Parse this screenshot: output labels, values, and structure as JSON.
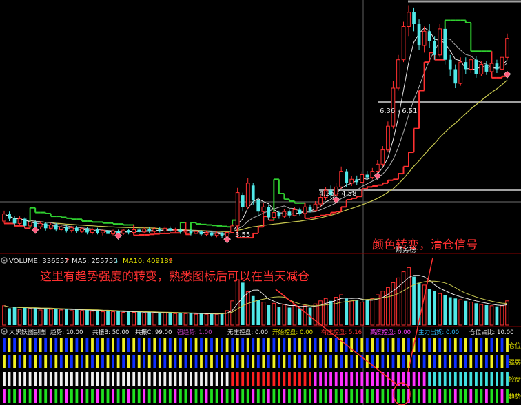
{
  "volume_panel": {
    "icon": "gear-icon",
    "volume": "VOLUME: 336557",
    "ma5": "MA5: 255750",
    "ma10": "MA10: 409189"
  },
  "indicator_panel": {
    "icon": "gear-icon",
    "name": "大黑妖图副图",
    "items": [
      {
        "text": "趋势: 10.00",
        "color": "#e8e8e8"
      },
      {
        "text": "共振B: 50.00",
        "color": "#e8e8e8"
      },
      {
        "text": "共振C: 99.00",
        "color": "#e8e8e8"
      },
      {
        "text": "强趋势: 1.00",
        "color": "#c040c0"
      },
      {
        "text": "无庄控盘: 0.00",
        "color": "#e8e8e8"
      },
      {
        "text": "开始控盘: 0.00",
        "color": "#e0e000"
      },
      {
        "text": "有庄控盘: 5.16",
        "color": "#ff3030"
      },
      {
        "text": "高度控盘: 0.00",
        "color": "#ff40ff"
      },
      {
        "text": "主力出货: 0.00",
        "color": "#30c0ff"
      },
      {
        "text": "仓位占比: 10.00",
        "color": "#e8e8e8"
      }
    ],
    "row_labels": [
      "仓位",
      "强弱",
      "控盘",
      "趋势"
    ]
  },
  "price_labels": {
    "low": "3.55",
    "range_mid": "4.26 - 4.58",
    "range_high": "6.36 - 6.51",
    "signal": "财务榜"
  },
  "annotations": {
    "left": "这里有趋势强度的转变，熟悉图标后可以在当天减仓",
    "right": "颜色转变，清仓信号"
  },
  "colors": {
    "up": "#ff3030",
    "down": "#50e8e8",
    "ma_white": "#e8e8e8",
    "ma_yellow": "#c8c850",
    "ma_green": "#30d030",
    "annotation": "#ff3030",
    "bar_blue": "#1030ff",
    "bar_yellow": "#f0f020",
    "bar_white": "#f0f0f0",
    "bar_green": "#20e020",
    "bar_magenta": "#ff30ff",
    "bar_red": "#ff2020",
    "bar_cyan": "#40e0e0"
  },
  "chart_data": {
    "type": "candlestick",
    "candles": [
      [
        3.9,
        4.05,
        4.12,
        3.85
      ],
      [
        4.05,
        3.95,
        4.1,
        3.9
      ],
      [
        3.95,
        3.85,
        4.0,
        3.8
      ],
      [
        3.85,
        3.95,
        4.0,
        3.8
      ],
      [
        3.95,
        3.8,
        3.98,
        3.75
      ],
      [
        3.8,
        3.88,
        3.92,
        3.76
      ],
      [
        3.88,
        3.78,
        3.92,
        3.74
      ],
      [
        3.78,
        3.85,
        3.9,
        3.74
      ],
      [
        3.85,
        3.75,
        3.88,
        3.7
      ],
      [
        3.75,
        3.82,
        3.86,
        3.72
      ],
      [
        3.82,
        3.72,
        3.86,
        3.68
      ],
      [
        3.72,
        3.78,
        3.82,
        3.68
      ],
      [
        3.78,
        3.7,
        3.82,
        3.66
      ],
      [
        3.7,
        3.76,
        3.8,
        3.66
      ],
      [
        3.76,
        3.68,
        3.8,
        3.64
      ],
      [
        3.68,
        3.74,
        3.78,
        3.64
      ],
      [
        3.74,
        3.66,
        3.78,
        3.62
      ],
      [
        3.66,
        3.72,
        3.76,
        3.62
      ],
      [
        3.72,
        3.65,
        3.76,
        3.62
      ],
      [
        3.65,
        3.7,
        3.74,
        3.6
      ],
      [
        3.7,
        3.63,
        3.74,
        3.6
      ],
      [
        3.63,
        3.69,
        3.72,
        3.6
      ],
      [
        3.69,
        3.64,
        3.72,
        3.61
      ],
      [
        3.64,
        3.71,
        3.74,
        3.61
      ],
      [
        3.71,
        3.66,
        3.74,
        3.62
      ],
      [
        3.66,
        3.72,
        3.76,
        3.63
      ],
      [
        3.72,
        3.67,
        3.76,
        3.64
      ],
      [
        3.67,
        3.73,
        3.77,
        3.64
      ],
      [
        3.73,
        3.68,
        3.77,
        3.65
      ],
      [
        3.68,
        3.74,
        3.78,
        3.65
      ],
      [
        3.74,
        3.69,
        3.78,
        3.66
      ],
      [
        3.69,
        3.75,
        3.79,
        3.66
      ],
      [
        3.75,
        3.7,
        3.79,
        3.67
      ],
      [
        3.7,
        3.72,
        3.76,
        3.66
      ],
      [
        3.72,
        3.67,
        3.75,
        3.63
      ],
      [
        3.67,
        3.7,
        3.74,
        3.62
      ],
      [
        3.7,
        3.64,
        3.73,
        3.6
      ],
      [
        3.64,
        3.68,
        3.72,
        3.6
      ],
      [
        3.68,
        3.62,
        3.71,
        3.58
      ],
      [
        3.62,
        3.66,
        3.7,
        3.58
      ],
      [
        3.66,
        3.6,
        3.69,
        3.57
      ],
      [
        3.6,
        3.64,
        3.68,
        3.56
      ],
      [
        3.64,
        3.58,
        3.67,
        3.55
      ],
      [
        3.58,
        3.66,
        3.7,
        3.55
      ],
      [
        3.66,
        3.8,
        3.84,
        3.64
      ],
      [
        3.8,
        4.5,
        4.6,
        3.78
      ],
      [
        4.45,
        4.2,
        4.5,
        4.1
      ],
      [
        4.2,
        4.7,
        4.8,
        4.15
      ],
      [
        4.65,
        4.35,
        4.7,
        4.25
      ],
      [
        4.35,
        4.1,
        4.4,
        4.0
      ],
      [
        4.1,
        4.2,
        4.28,
        4.02
      ],
      [
        4.2,
        3.98,
        4.24,
        3.92
      ],
      [
        3.98,
        4.08,
        4.14,
        3.94
      ],
      [
        4.08,
        4.0,
        4.12,
        3.95
      ],
      [
        4.0,
        4.1,
        4.16,
        3.96
      ],
      [
        4.1,
        4.02,
        4.14,
        3.97
      ],
      [
        4.02,
        4.14,
        4.2,
        4.0
      ],
      [
        4.14,
        4.06,
        4.18,
        4.02
      ],
      [
        4.06,
        4.2,
        4.26,
        4.04
      ],
      [
        4.2,
        4.12,
        4.25,
        4.08
      ],
      [
        4.12,
        4.26,
        4.32,
        4.1
      ],
      [
        4.26,
        4.4,
        4.48,
        4.2
      ],
      [
        4.4,
        4.55,
        4.62,
        4.35
      ],
      [
        4.55,
        4.45,
        4.65,
        4.38
      ],
      [
        4.45,
        4.62,
        4.7,
        4.42
      ],
      [
        4.62,
        4.95,
        5.05,
        4.58
      ],
      [
        4.95,
        4.7,
        5.0,
        4.62
      ],
      [
        4.7,
        4.78,
        4.85,
        4.64
      ],
      [
        4.78,
        4.72,
        4.86,
        4.66
      ],
      [
        4.72,
        4.88,
        4.95,
        4.7
      ],
      [
        4.88,
        4.82,
        4.96,
        4.76
      ],
      [
        4.82,
        4.95,
        5.02,
        4.78
      ],
      [
        4.95,
        5.1,
        5.18,
        4.9
      ],
      [
        5.1,
        5.4,
        5.48,
        5.05
      ],
      [
        5.4,
        5.9,
        6.0,
        5.35
      ],
      [
        5.9,
        6.7,
        6.85,
        5.85
      ],
      [
        6.7,
        7.3,
        7.4,
        6.65
      ],
      [
        7.3,
        8.0,
        8.1,
        7.25
      ],
      [
        8.0,
        8.3,
        8.45,
        7.8
      ],
      [
        8.3,
        8.05,
        8.4,
        7.9
      ],
      [
        8.05,
        7.6,
        8.15,
        7.5
      ],
      [
        7.6,
        7.9,
        8.0,
        7.45
      ],
      [
        7.9,
        7.7,
        8.05,
        7.55
      ],
      [
        7.7,
        7.4,
        7.8,
        7.3
      ],
      [
        7.4,
        7.95,
        8.05,
        7.35
      ],
      [
        7.95,
        7.3,
        8.0,
        7.2
      ],
      [
        7.3,
        7.1,
        7.4,
        6.95
      ],
      [
        7.1,
        6.8,
        7.2,
        6.7
      ],
      [
        6.8,
        7.25,
        7.35,
        6.75
      ],
      [
        7.25,
        7.1,
        7.35,
        7.0
      ],
      [
        7.1,
        7.3,
        7.4,
        7.02
      ],
      [
        7.3,
        7.0,
        7.38,
        6.92
      ],
      [
        7.0,
        7.2,
        7.28,
        6.95
      ],
      [
        7.2,
        7.05,
        7.28,
        6.98
      ],
      [
        7.05,
        7.22,
        7.3,
        7.0
      ],
      [
        7.22,
        7.1,
        7.3,
        7.02
      ],
      [
        7.1,
        7.35,
        7.45,
        7.05
      ],
      [
        7.35,
        7.75,
        7.85,
        7.3
      ]
    ],
    "volume": [
      0.32,
      0.28,
      0.3,
      0.26,
      0.3,
      0.27,
      0.29,
      0.25,
      0.28,
      0.26,
      0.27,
      0.25,
      0.27,
      0.24,
      0.26,
      0.24,
      0.25,
      0.23,
      0.25,
      0.22,
      0.24,
      0.22,
      0.23,
      0.21,
      0.23,
      0.21,
      0.22,
      0.2,
      0.22,
      0.2,
      0.21,
      0.2,
      0.21,
      0.19,
      0.2,
      0.19,
      0.2,
      0.18,
      0.19,
      0.18,
      0.19,
      0.18,
      0.2,
      0.24,
      0.4,
      0.75,
      0.7,
      0.55,
      0.48,
      0.42,
      0.38,
      0.33,
      0.36,
      0.3,
      0.34,
      0.29,
      0.33,
      0.28,
      0.32,
      0.29,
      0.35,
      0.4,
      0.44,
      0.4,
      0.46,
      0.5,
      0.44,
      0.4,
      0.42,
      0.38,
      0.41,
      0.44,
      0.5,
      0.56,
      0.62,
      0.7,
      0.78,
      0.88,
      0.95,
      0.8,
      0.7,
      0.66,
      0.6,
      0.56,
      0.52,
      0.5,
      0.46,
      0.44,
      0.42,
      0.4,
      0.38,
      0.36,
      0.34,
      0.33,
      0.32,
      0.31,
      0.32,
      0.4
    ]
  }
}
